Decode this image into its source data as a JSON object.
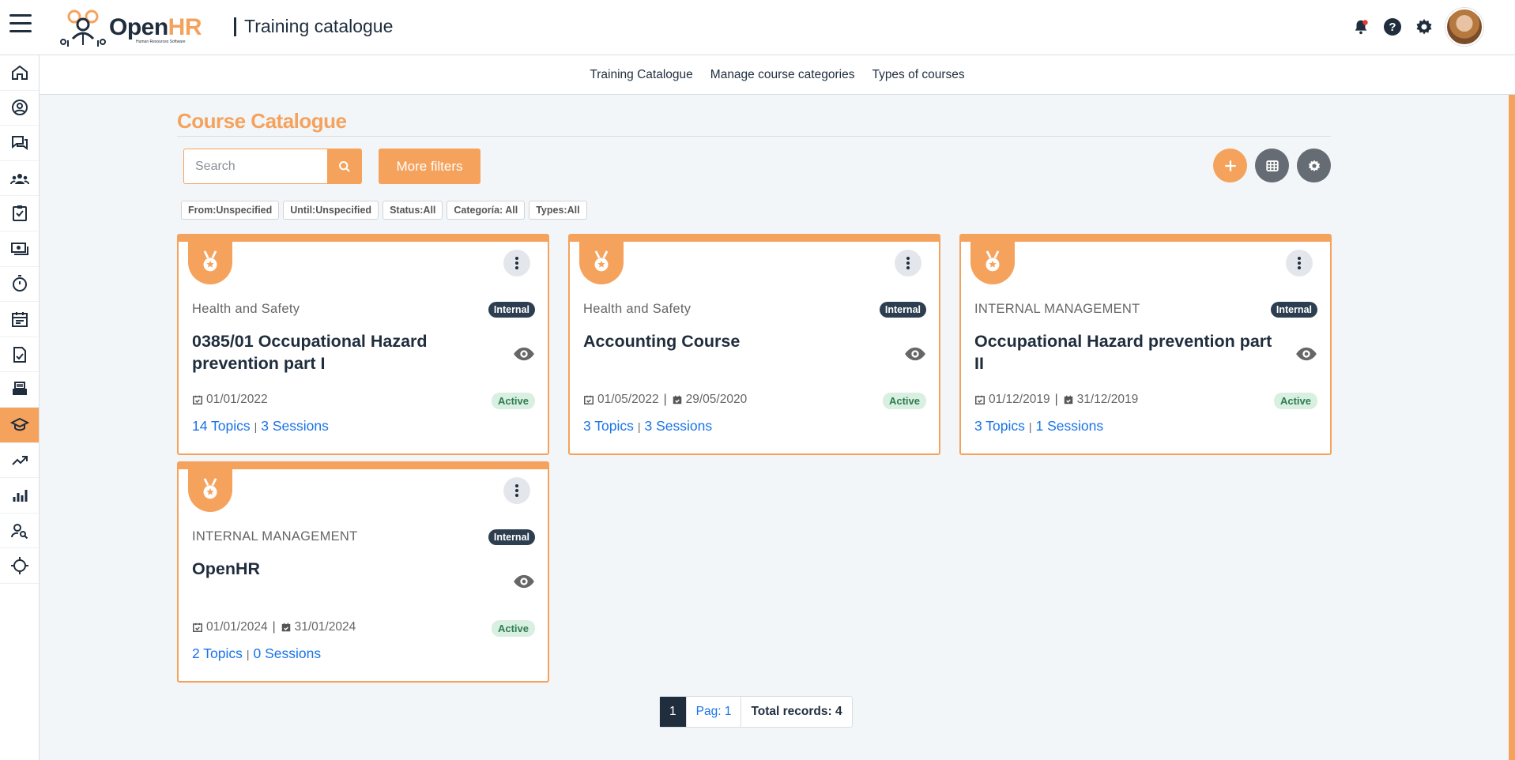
{
  "header": {
    "logo_text_a": "Open",
    "logo_text_b": "HR",
    "logo_subtitle": "Human Resources Software",
    "page_title": "Training catalogue"
  },
  "subnav": {
    "items": [
      "Training Catalogue",
      "Manage course categories",
      "Types of courses"
    ]
  },
  "sidebar": {
    "icons": [
      "home-icon",
      "user-circle-icon",
      "chat-icon",
      "team-icon",
      "checklist-icon",
      "payroll-icon",
      "stopwatch-icon",
      "calendar-icon",
      "document-check-icon",
      "printer-icon",
      "graduation-cap-icon",
      "trend-icon",
      "bar-chart-icon",
      "user-search-icon",
      "target-icon"
    ],
    "active_index": 10
  },
  "main": {
    "title": "Course Catalogue",
    "search_placeholder": "Search",
    "more_filters_label": "More filters",
    "chips": [
      "From:Unspecified",
      "Until:Unspecified",
      "Status:All",
      "Categoría: All",
      "Types:All"
    ]
  },
  "courses": [
    {
      "category": "Health and Safety",
      "type": "Internal",
      "title": "0385/01 Occupational Hazard prevention part I",
      "date_start": "01/01/2022",
      "date_end": "",
      "status": "Active",
      "topics": "14 Topics",
      "sessions": "3 Sessions"
    },
    {
      "category": "Health and Safety",
      "type": "Internal",
      "title": "Accounting Course",
      "date_start": "01/05/2022",
      "date_end": "29/05/2020",
      "status": "Active",
      "topics": "3 Topics",
      "sessions": "3 Sessions"
    },
    {
      "category": "INTERNAL MANAGEMENT",
      "type": "Internal",
      "title": "Occupational Hazard prevention part II",
      "date_start": "01/12/2019",
      "date_end": "31/12/2019",
      "status": "Active",
      "topics": "3 Topics",
      "sessions": "1 Sessions"
    },
    {
      "category": "INTERNAL MANAGEMENT",
      "type": "Internal",
      "title": "OpenHR",
      "date_start": "01/01/2024",
      "date_end": "31/01/2024",
      "status": "Active",
      "topics": "2 Topics",
      "sessions": "0 Sessions"
    }
  ],
  "pagination": {
    "current": "1",
    "page_label": "Pag: 1",
    "total_label": "Total records: 4"
  },
  "colors": {
    "accent": "#f5a25d",
    "dark": "#1f2d3d",
    "link": "#1a73e8"
  }
}
